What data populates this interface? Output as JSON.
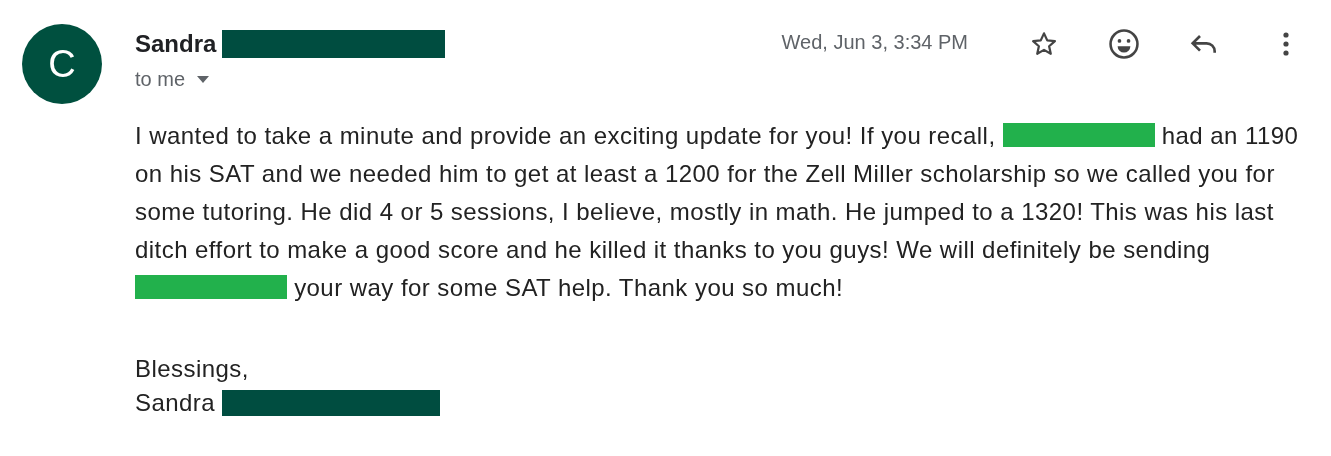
{
  "avatar": {
    "initial": "C"
  },
  "sender": {
    "name": "Sandra",
    "redaction": {
      "color": "#004d40"
    }
  },
  "recipient": {
    "label": "to me",
    "expanded": false
  },
  "date": "Wed, Jun 3, 3:34 PM",
  "body": [
    {
      "kind": "text",
      "text": "I wanted to take a minute and provide an exciting update for you! If you recall,"
    },
    {
      "kind": "redaction",
      "color": "#22b14c"
    },
    {
      "kind": "text",
      "text": "had an 1190 on his SAT and we needed him to get at least a 1200 for the Zell Miller scholarship so we called you for some tutoring. He did 4 or 5 sessions, I believe, mostly in math. He jumped to a 1320! This was his last ditch effort to make a good score and he killed it thanks to you guys! We will definitely be sending"
    },
    {
      "kind": "redaction",
      "color": "#22b14c"
    },
    {
      "kind": "text",
      "text": "your way for some SAT help. Thank you so much!"
    }
  ],
  "closing": "Blessings,",
  "signature": {
    "name": "Sandra",
    "redaction": {
      "color": "#004d40"
    }
  }
}
